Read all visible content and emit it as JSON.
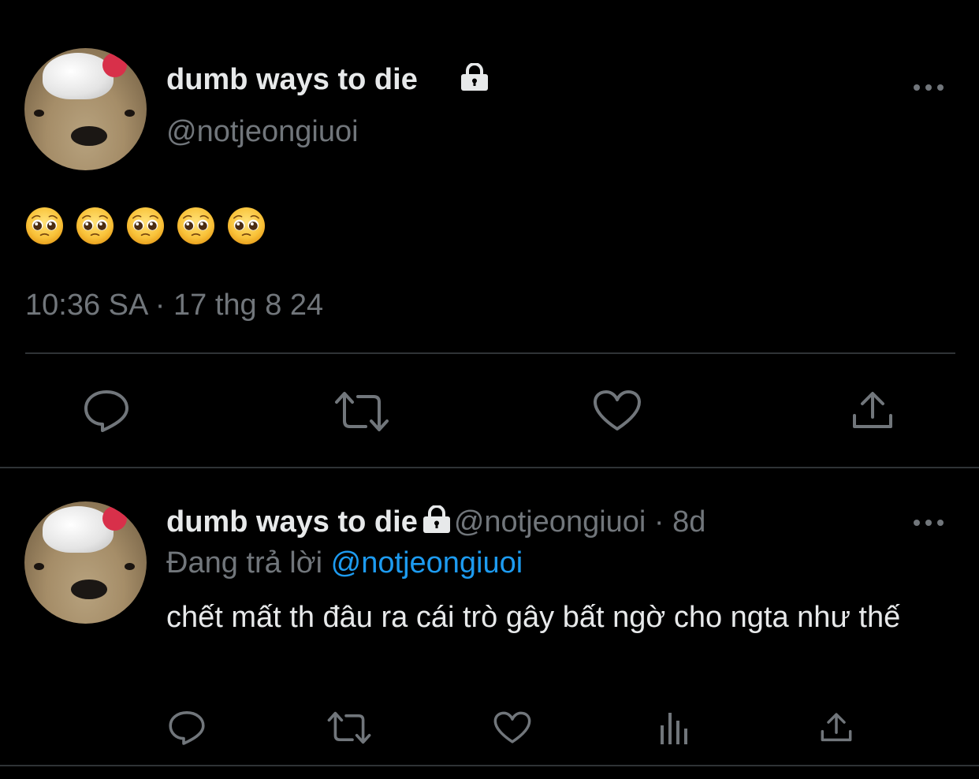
{
  "main_tweet": {
    "display_name": "dumb ways to die",
    "handle": "@notjeongiuoi",
    "emoji_text": "🥺🥺🥺🥺🥺",
    "emoji_count": 5,
    "timestamp": "10:36 SA · 17 thg 8 24"
  },
  "reply_tweet": {
    "display_name": "dumb ways to die",
    "handle": "@notjeongiuoi",
    "separator": "·",
    "age": "8d",
    "replying_label": "Đang trả lời",
    "replying_to": "@notjeongiuoi",
    "text": "chết mất th đâu ra cái trò gây bất ngờ cho ngta như thế"
  },
  "icons": {
    "avatar": "dog-with-whipped-cream-avatar",
    "lock": "lock-icon",
    "more": "more-dots-icon",
    "reply": "reply-bubble-icon",
    "retweet": "retweet-icon",
    "like": "heart-icon",
    "share": "share-icon",
    "views": "views-bar-chart-icon"
  },
  "colors": {
    "background": "#000000",
    "text": "#e7e9ea",
    "secondary": "#71767b",
    "link": "#1d9bf0",
    "divider": "#2f3336"
  }
}
